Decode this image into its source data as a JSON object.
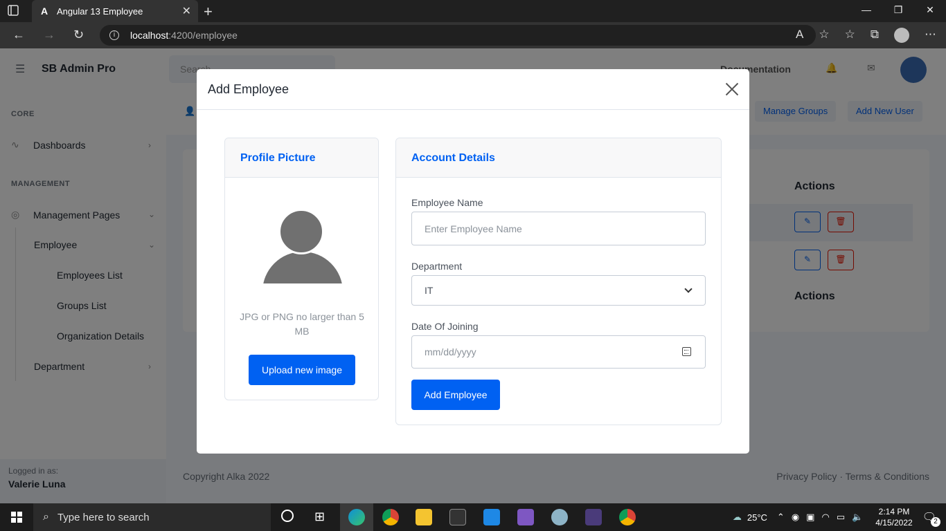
{
  "browser": {
    "tab_title": "Angular 13 Employee",
    "favicon": "A",
    "url_host": "localhost",
    "url_path": ":4200/employee"
  },
  "app": {
    "brand": "SB Admin Pro",
    "search_placeholder": "Search",
    "documentation": "Documentation",
    "sidebar": {
      "core_heading": "CORE",
      "dashboards": "Dashboards",
      "management_heading": "MANAGEMENT",
      "management_pages": "Management Pages",
      "employee": "Employee",
      "employees_list": "Employees List",
      "groups_list": "Groups List",
      "organization_details": "Organization Details",
      "department": "Department",
      "logged_in_as": "Logged in as:",
      "user_name": "Valerie Luna"
    },
    "header_buttons": {
      "manage_groups": "Manage Groups",
      "add_new_user": "Add New User"
    },
    "table": {
      "actions_header": "Actions",
      "actions_footer": "Actions"
    },
    "footer": {
      "copyright": "Copyright Alka 2022",
      "links": "Privacy Policy · Terms & Conditions"
    }
  },
  "modal": {
    "title": "Add Employee",
    "profile": {
      "header": "Profile Picture",
      "hint": "JPG or PNG no larger than 5 MB",
      "upload_button": "Upload new image"
    },
    "account": {
      "header": "Account Details",
      "name_label": "Employee Name",
      "name_placeholder": "Enter Employee Name",
      "department_label": "Department",
      "department_value": "IT",
      "doj_label": "Date Of Joining",
      "doj_placeholder": "mm/dd/yyyy",
      "submit_button": "Add Employee"
    }
  },
  "taskbar": {
    "search_placeholder": "Type here to search",
    "temperature": "25°C",
    "time": "2:14 PM",
    "date": "4/15/2022",
    "notifications": "2"
  },
  "colors": {
    "primary": "#0061f2",
    "danger": "#e81500"
  }
}
